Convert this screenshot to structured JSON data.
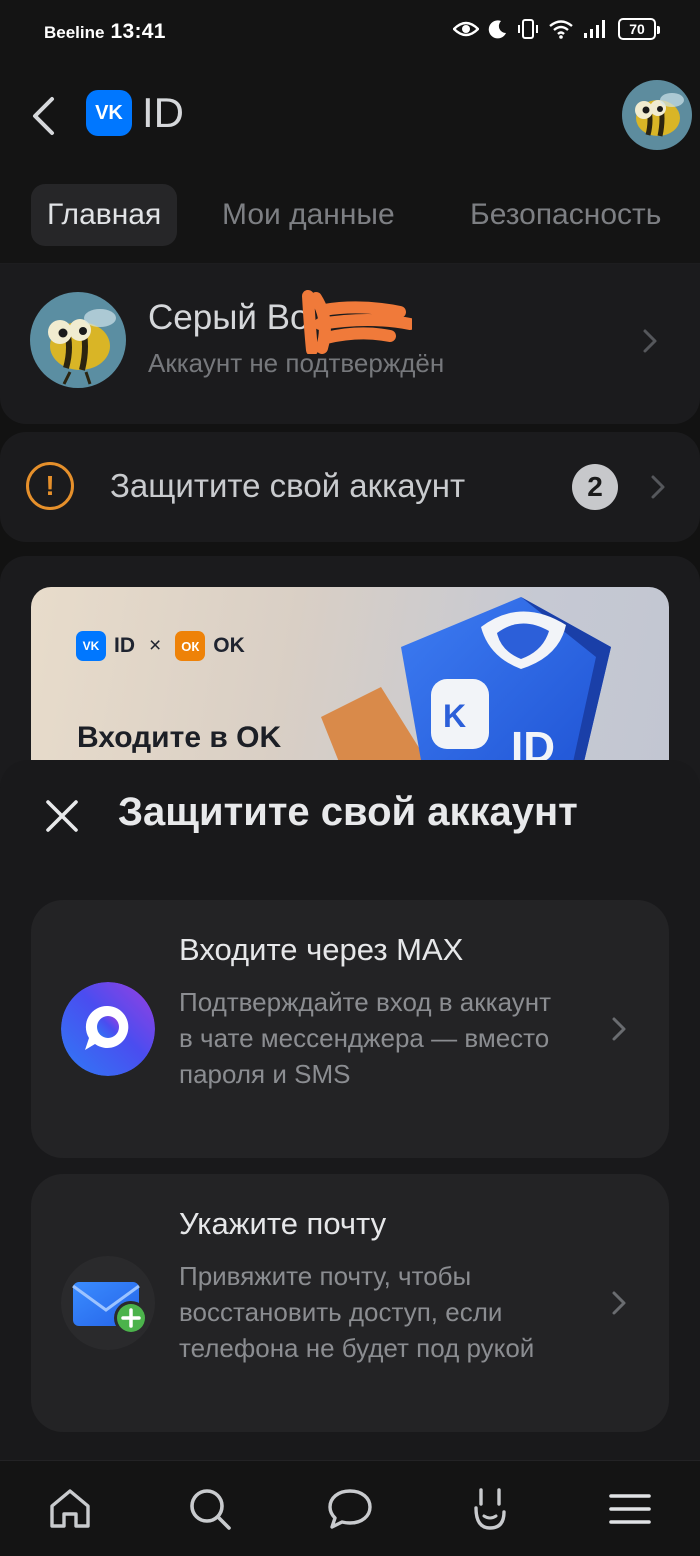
{
  "status_bar": {
    "carrier": "Beeline",
    "time": "13:41",
    "battery": "70",
    "icons": [
      "eye-icon",
      "moon-icon",
      "vibrate-icon",
      "wifi-icon",
      "signal-icon",
      "battery-icon"
    ]
  },
  "header": {
    "logo_mark": "VK",
    "logo_text": "ID"
  },
  "tabs": [
    {
      "label": "Главная",
      "active": true
    },
    {
      "label": "Мои данные",
      "active": false
    },
    {
      "label": "Безопасность",
      "active": false
    }
  ],
  "profile": {
    "name": "Серый Во",
    "status": "Аккаунт не подтверждён"
  },
  "protect": {
    "label": "Защитите свой аккаунт",
    "count": "2",
    "accent": "#e6902b"
  },
  "promo": {
    "logo_vk": "ID",
    "separator": "×",
    "logo_ok": "OK",
    "title": "Входите в OK"
  },
  "sheet": {
    "title": "Защитите свой аккаунт",
    "options": [
      {
        "title": "Входите через MAX",
        "description": "Подтверждайте вход в аккаунт в чате мессенджера — вместо пароля и SMS",
        "icon": "max-messenger-icon"
      },
      {
        "title": "Укажите почту",
        "description": "Привяжите почту, чтобы восстановить доступ, если телефона не будет под рукой",
        "icon": "mail-add-icon"
      }
    ]
  },
  "nav": [
    "home-icon",
    "search-icon",
    "chat-icon",
    "services-icon",
    "menu-icon"
  ],
  "colors": {
    "background": "#121212",
    "card": "#1b1b1d",
    "vk_blue": "#0077ff",
    "warning": "#e6902b"
  }
}
